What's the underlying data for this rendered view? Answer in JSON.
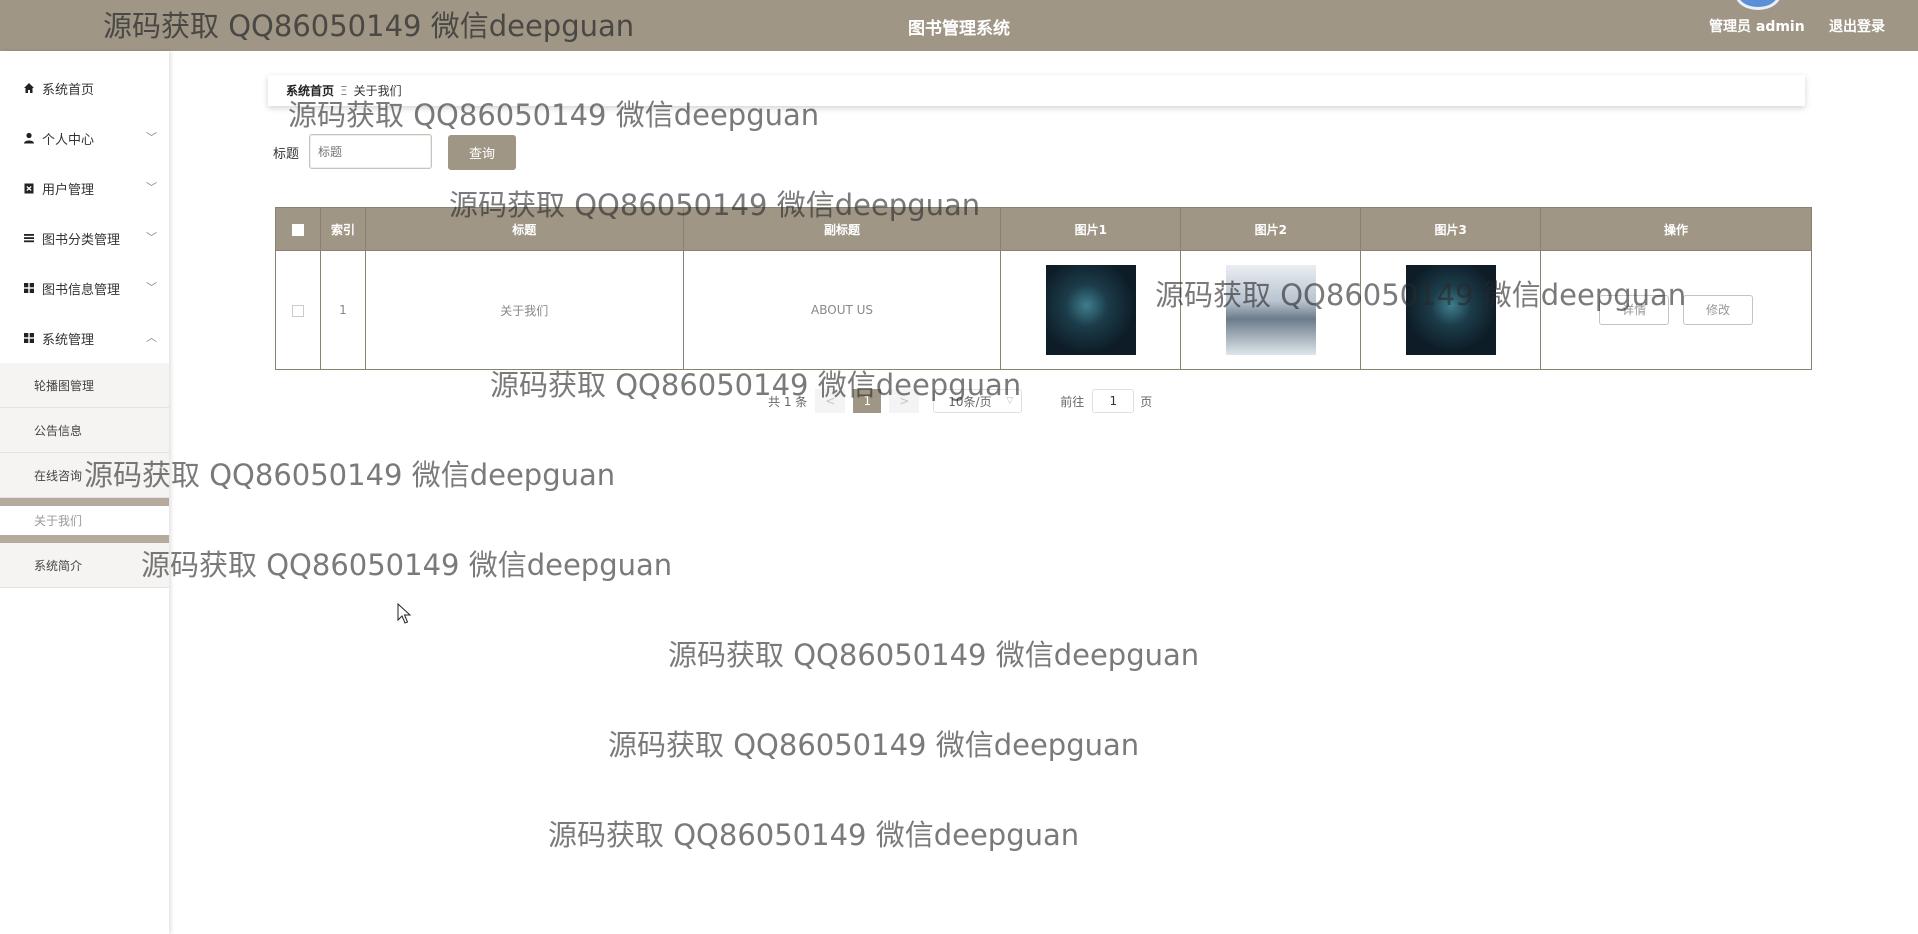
{
  "header": {
    "title": "图书管理系统",
    "admin_label": "管理员 admin",
    "logout_label": "退出登录"
  },
  "sidebar": {
    "items": [
      {
        "label": "系统首页",
        "icon": "home-icon"
      },
      {
        "label": "个人中心",
        "icon": "user-icon",
        "chevron": "﹀"
      },
      {
        "label": "用户管理",
        "icon": "user-manage-icon",
        "chevron": "﹀"
      },
      {
        "label": "图书分类管理",
        "icon": "list-icon",
        "chevron": "﹀"
      },
      {
        "label": "图书信息管理",
        "icon": "grid-icon",
        "chevron": "﹀"
      },
      {
        "label": "系统管理",
        "icon": "grid-icon",
        "chevron": "︿"
      }
    ],
    "sub_items": [
      {
        "label": "轮播图管理"
      },
      {
        "label": "公告信息"
      },
      {
        "label": "在线咨询"
      },
      {
        "label": "关于我们",
        "active": true
      },
      {
        "label": "系统简介"
      }
    ]
  },
  "breadcrumb": {
    "home": "系统首页",
    "separator": "Ξ",
    "current": "关于我们"
  },
  "search": {
    "label": "标题",
    "placeholder": "标题",
    "button_label": "查询"
  },
  "table": {
    "headers": [
      "索引",
      "标题",
      "副标题",
      "图片1",
      "图片2",
      "图片3",
      "操作"
    ],
    "rows": [
      {
        "index": "1",
        "title": "关于我们",
        "subtitle": "ABOUT US",
        "detail_label": "详情",
        "edit_label": "修改"
      }
    ]
  },
  "pagination": {
    "total": "共 1 条",
    "prev": "<",
    "current_page": "1",
    "next": ">",
    "page_size": "10条/页",
    "goto_label": "前往",
    "goto_value": "1",
    "goto_suffix": "页"
  },
  "watermark": "源码获取 QQ86050149 微信deepguan",
  "colors": {
    "header_bg": "#a09686",
    "accent": "#a09686"
  }
}
